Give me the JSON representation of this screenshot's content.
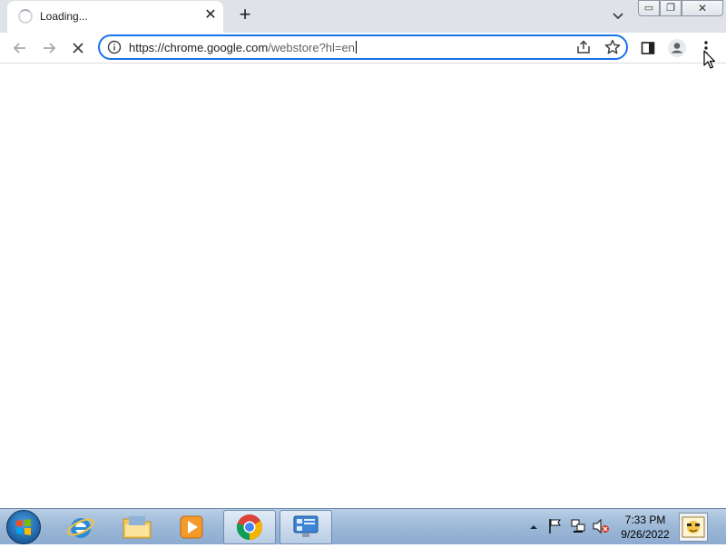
{
  "tab": {
    "title": "Loading...",
    "close_glyph": "✕",
    "new_tab_glyph": "+"
  },
  "toolbar": {
    "url_host": "https://chrome.google.com",
    "url_path": "/webstore?hl=en",
    "icons": [
      "back-icon",
      "forward-icon",
      "stop-icon",
      "info-icon",
      "share-icon",
      "star-icon",
      "side-panel-icon",
      "profile-icon",
      "menu-icon"
    ]
  },
  "window_controls": {
    "minimize": "▭",
    "maximize": "❐",
    "close": "✕"
  },
  "taskbar": {
    "apps": [
      "internet-explorer",
      "file-explorer",
      "media-player",
      "chrome",
      "control-panel"
    ],
    "active_app": "chrome",
    "time": "7:33 PM",
    "date": "9/26/2022"
  },
  "colors": {
    "accent": "#1a73e8",
    "tabstrip": "#dfe3e8"
  }
}
